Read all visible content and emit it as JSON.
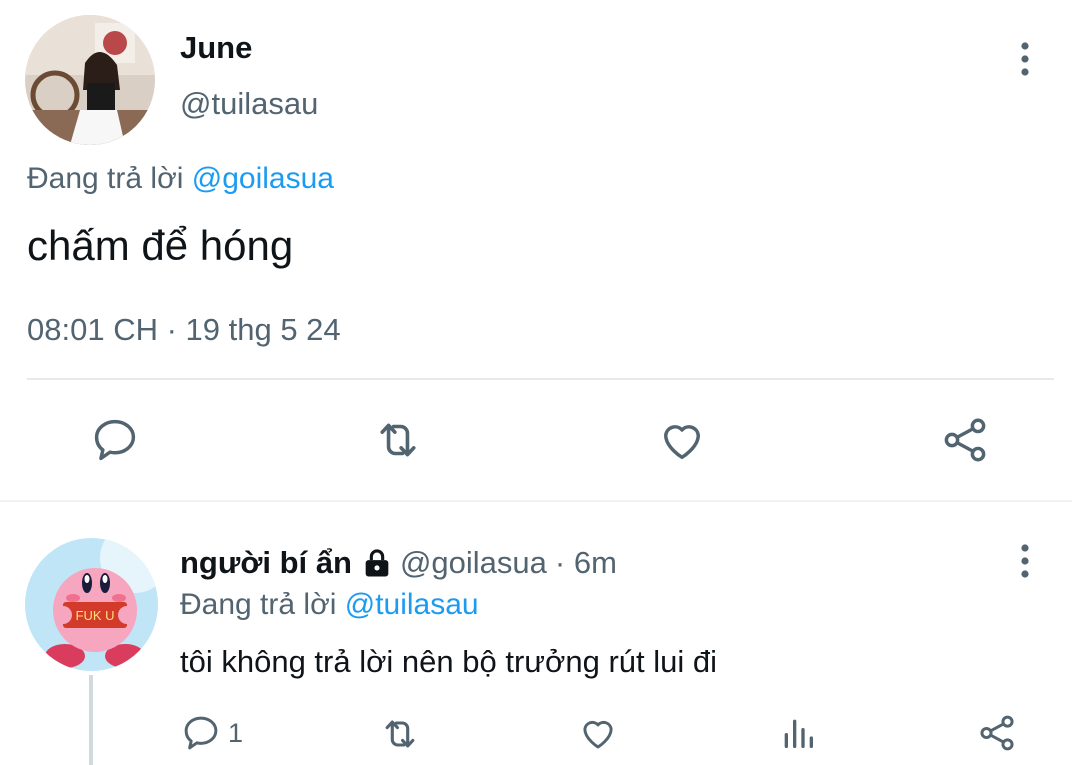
{
  "main_tweet": {
    "name": "June",
    "handle": "@tuilasau",
    "reply_prefix": "Đang trả lời",
    "reply_to": "@goilasua",
    "text": "chấm để hóng",
    "timestamp": "08:01 CH · 19 thg 5 24",
    "actions": [
      "reply-icon",
      "retweet-icon",
      "like-icon",
      "share-icon"
    ]
  },
  "reply_tweet": {
    "name": "người bí ẩn",
    "handle": "@goilasua",
    "time": "· 6m",
    "reply_prefix": "Đang trả lời",
    "reply_to": "@tuilasau",
    "text": "tôi không trả lời nên bộ trưởng rút lui đi",
    "reply_count": "1",
    "avatar_sign": "FUK U",
    "actions": [
      "reply-icon",
      "retweet-icon",
      "like-icon",
      "views-icon",
      "share-icon"
    ]
  },
  "colors": {
    "accent": "#1d9bf0",
    "secondary_text": "#536471",
    "divider": "#e7eaec"
  }
}
